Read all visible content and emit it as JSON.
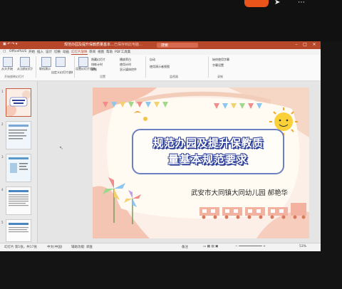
{
  "window": {
    "app_label": "OfficePLUS",
    "title_left": "规范办园及提升保教质量基本…",
    "title_right": "…已保存到此电脑…",
    "search_label": "搜索"
  },
  "tabs": [
    {
      "label": "开始"
    },
    {
      "label": "插入"
    },
    {
      "label": "设计"
    },
    {
      "label": "切换"
    },
    {
      "label": "动画"
    },
    {
      "label": "幻灯片放映"
    },
    {
      "label": "审阅"
    },
    {
      "label": "视图"
    },
    {
      "label": "帮助"
    },
    {
      "label": "PDF工具集"
    }
  ],
  "ribbon": {
    "groups": [
      "开始放映幻灯片",
      "设置",
      "监视器",
      "录制"
    ],
    "items": [
      "从头开始",
      "从当前幻灯片开始",
      "联机演示",
      "自定义幻灯片放映",
      "设置幻灯片放映",
      "隐藏幻灯片",
      "排练计时",
      "录制",
      "播放旁白",
      "使用计时",
      "显示媒体控件",
      "使用演示者视图",
      "自动",
      "始终使用字幕",
      "字幕设置"
    ]
  },
  "thumbnails": [
    {
      "num": "1",
      "selected": true
    },
    {
      "num": "2",
      "selected": false
    },
    {
      "num": "3",
      "selected": false
    },
    {
      "num": "4",
      "selected": false
    },
    {
      "num": "5",
      "selected": false
    }
  ],
  "slide": {
    "title_line1": "规范办园及提升保教质",
    "title_line2": "量基本规范要求",
    "author": "武安市大同镇大同幼儿园 郝艳华"
  },
  "status": {
    "slide_counter": "幻灯片 第1张，共17张",
    "language": "中文(中国)",
    "accessibility": "辅助功能: 调查",
    "notes": "备注",
    "zoom": "53%"
  },
  "colors": {
    "accent": "#b7472a",
    "title_outline": "#2c3f9a",
    "card_border": "#6d7fc1"
  }
}
